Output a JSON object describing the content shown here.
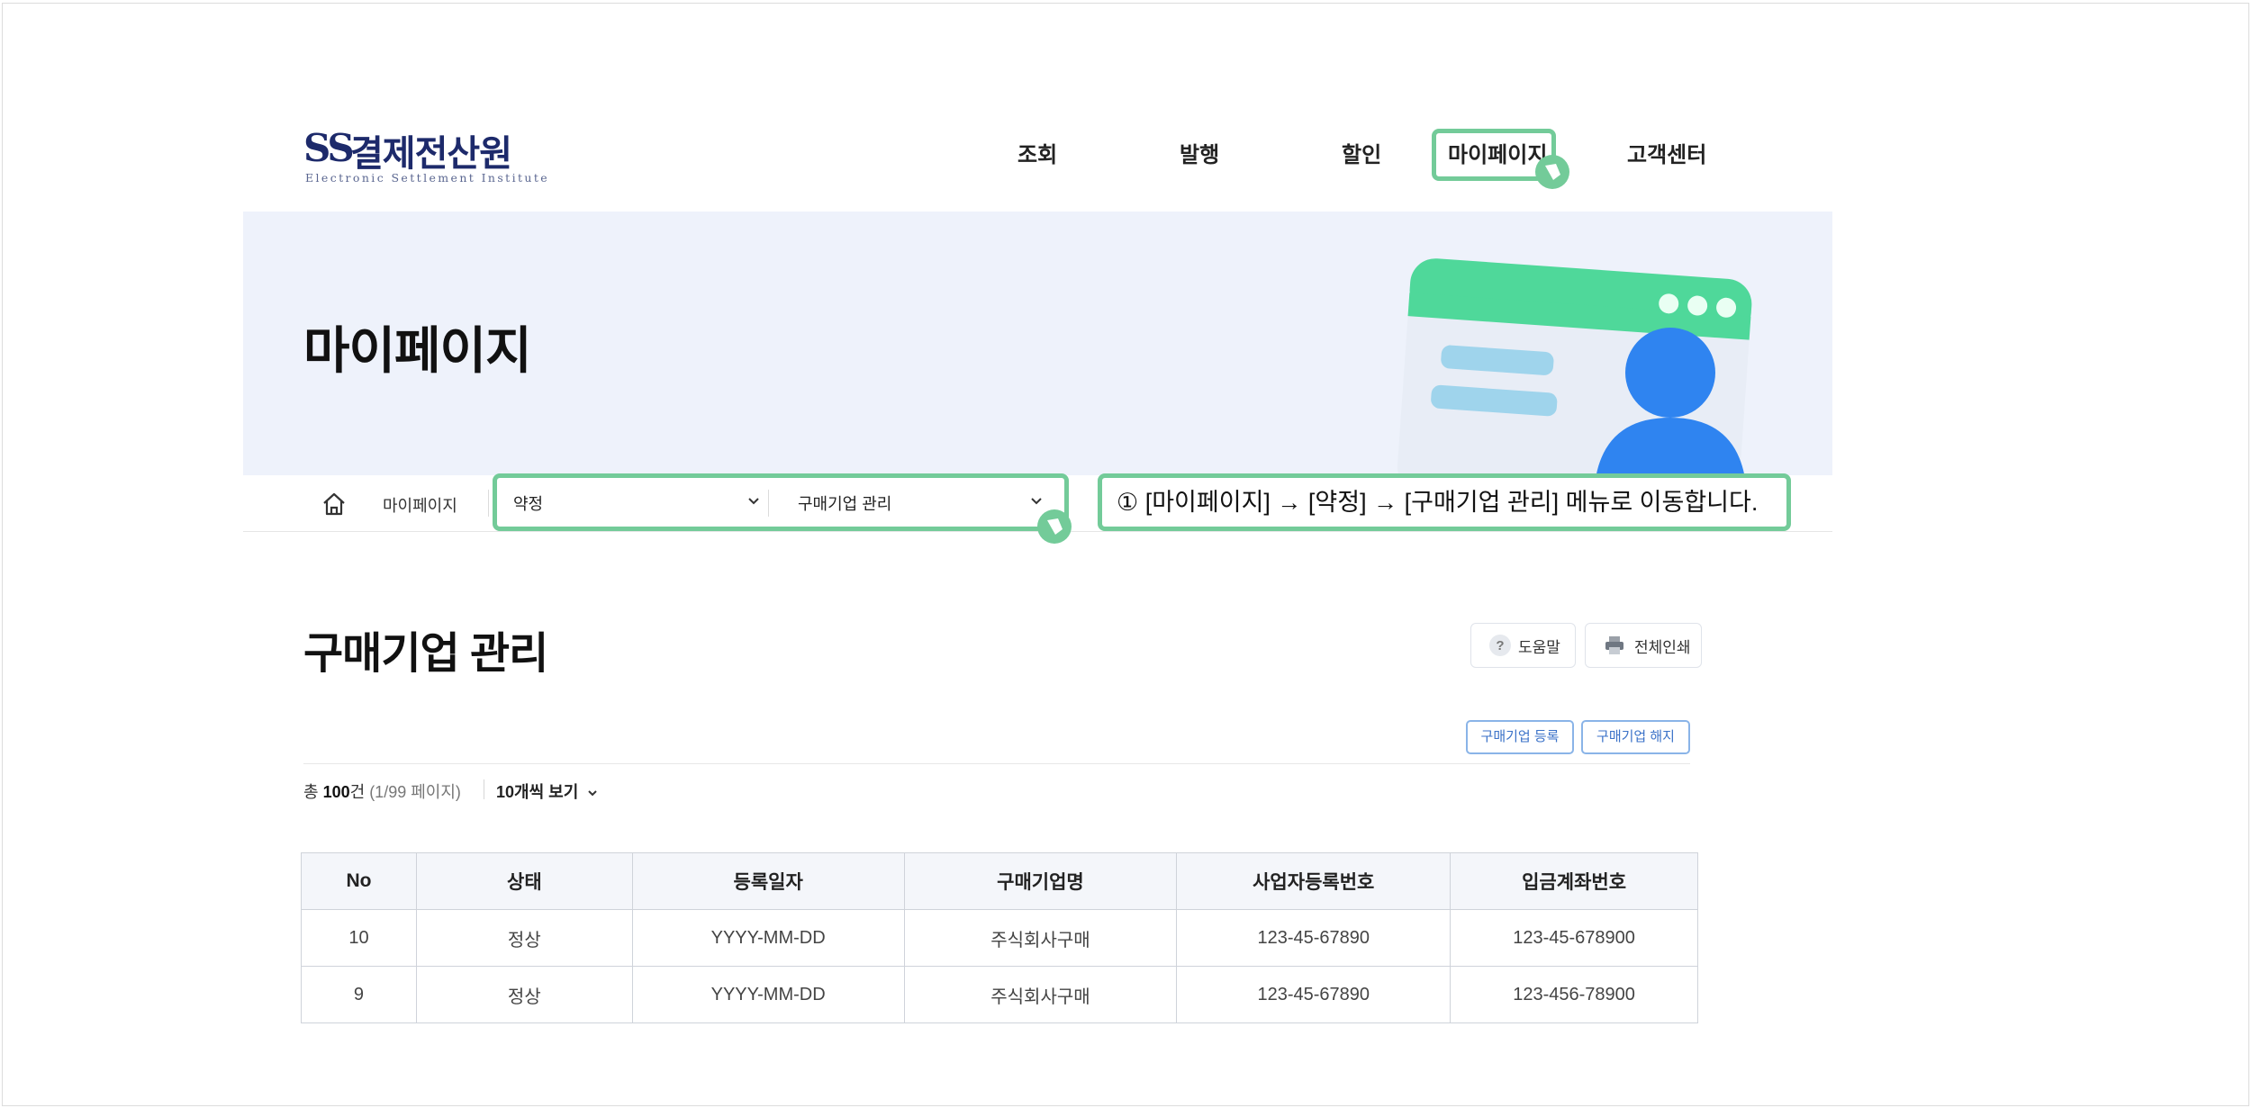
{
  "header": {
    "logo_mark": "SS",
    "logo_name": "결제전산원",
    "logo_sub": "Electronic Settlement Institute",
    "nav": [
      "조회",
      "발행",
      "할인",
      "마이페이지",
      "고객센터"
    ]
  },
  "hero": {
    "title": "마이페이지"
  },
  "breadcrumb": {
    "home_icon": "home-icon",
    "current": "마이페이지",
    "select1": "약정",
    "select2": "구매기업 관리"
  },
  "note": "① [마이페이지] → [약정] → [구매기업 관리] 메뉴로 이동합니다.",
  "content": {
    "title": "구매기업 관리",
    "help_label": "도움말",
    "print_label": "전체인쇄",
    "register_label": "구매기업 등록",
    "cancel_label": "구매기업 해지",
    "total_prefix": "총 ",
    "total_count": "100",
    "total_suffix": "건",
    "page_info": "(1/99 페이지)",
    "per_page": "10개씩 보기"
  },
  "table": {
    "headers": [
      "No",
      "상태",
      "등록일자",
      "구매기업명",
      "사업자등록번호",
      "입금계좌번호"
    ],
    "rows": [
      [
        "10",
        "정상",
        "YYYY-MM-DD",
        "주식회사구매",
        "123-45-67890",
        "123-45-678900"
      ],
      [
        "9",
        "정상",
        "YYYY-MM-DD",
        "주식회사구매",
        "123-45-67890",
        "123-456-78900"
      ]
    ]
  },
  "colors": {
    "brand_navy": "#1d2a6b",
    "highlight_green": "#73cb99",
    "hero_bg": "#eef2fb",
    "action_blue": "#3b72c8"
  }
}
